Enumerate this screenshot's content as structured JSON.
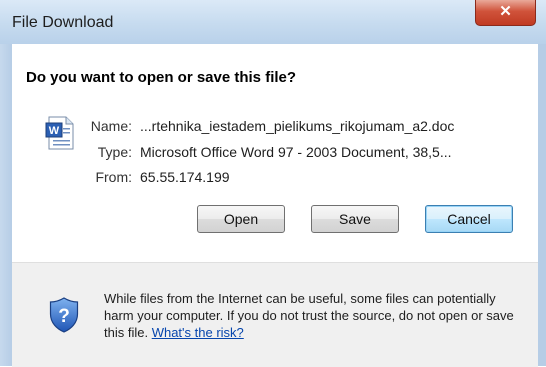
{
  "window": {
    "title": "File Download",
    "close_glyph": "✕"
  },
  "dialog": {
    "question": "Do you want to open or save this file?",
    "file": {
      "icon": "word-document-icon",
      "name_label": "Name:",
      "name_value": "...rtehnika_iestadem_pielikums_rikojumam_a2.doc",
      "type_label": "Type:",
      "type_value": "Microsoft Office Word 97 - 2003 Document, 38,5...",
      "from_label": "From:",
      "from_value": "65.55.174.199"
    },
    "buttons": {
      "open": "Open",
      "save": "Save",
      "cancel": "Cancel"
    },
    "warning": {
      "icon": "shield-question-icon",
      "text": "While files from the Internet can be useful, some files can potentially harm your computer. If you do not trust the source, do not open or save this file.",
      "link": "What's the risk?"
    }
  },
  "colors": {
    "accent": "#3c7fb1",
    "close": "#c03a22",
    "link": "#0645ad"
  }
}
